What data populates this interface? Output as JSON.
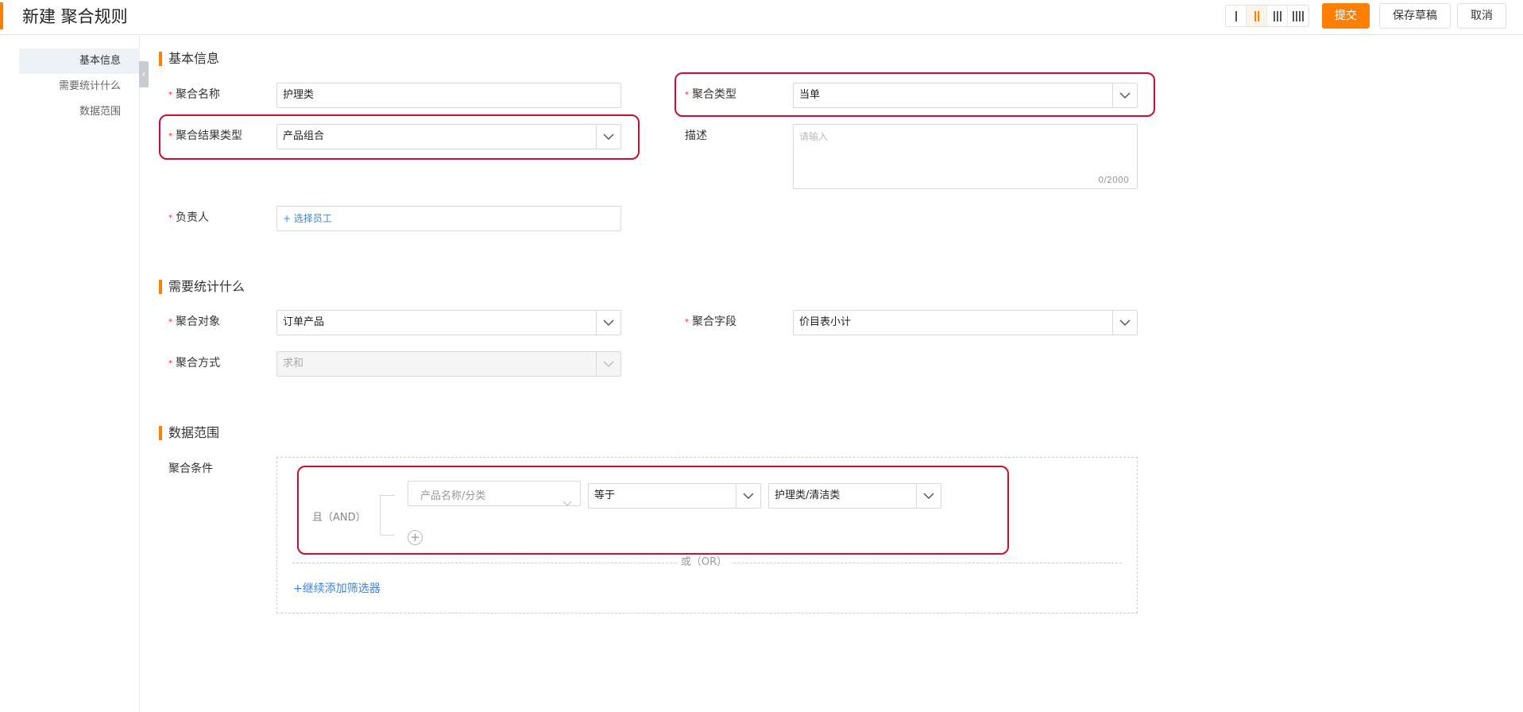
{
  "header": {
    "title": "新建 聚合规则",
    "submit_label": "提交",
    "save_draft_label": "保存草稿",
    "cancel_label": "取消",
    "layout_options": [
      "1 column",
      "2 columns",
      "3 columns",
      "4 columns"
    ],
    "active_layout": "2 columns"
  },
  "sidebar": {
    "items": [
      {
        "label": "基本信息",
        "active": true
      },
      {
        "label": "需要统计什么",
        "active": false
      },
      {
        "label": "数据范围",
        "active": false
      }
    ]
  },
  "sections": {
    "basic": "基本信息",
    "what": "需要统计什么",
    "scope": "数据范围"
  },
  "basic": {
    "name_label": "聚合名称",
    "name_value": "护理类",
    "type_label": "聚合类型",
    "type_value": "当单",
    "result_type_label": "聚合结果类型",
    "result_type_value": "产品组合",
    "desc_label": "描述",
    "desc_placeholder": "请输入",
    "desc_counter": "0/2000",
    "owner_label": "负责人",
    "owner_link": "+ 选择员工"
  },
  "what": {
    "object_label": "聚合对象",
    "object_value": "订单产品",
    "field_label": "聚合字段",
    "field_value": "价目表小计",
    "method_label": "聚合方式",
    "method_value": "求和"
  },
  "scope": {
    "condition_label": "聚合条件",
    "and_label": "且（AND）",
    "field_placeholder": "产品名称/分类",
    "operator_value": "等于",
    "value_value": "护理类/清洁类",
    "or_label": "或（OR）",
    "add_filter_label": "+继续添加筛选器"
  },
  "colors": {
    "accent": "#ff8000",
    "link": "#3b84d6",
    "highlight": "#c8102e",
    "required": "#f5222d"
  }
}
